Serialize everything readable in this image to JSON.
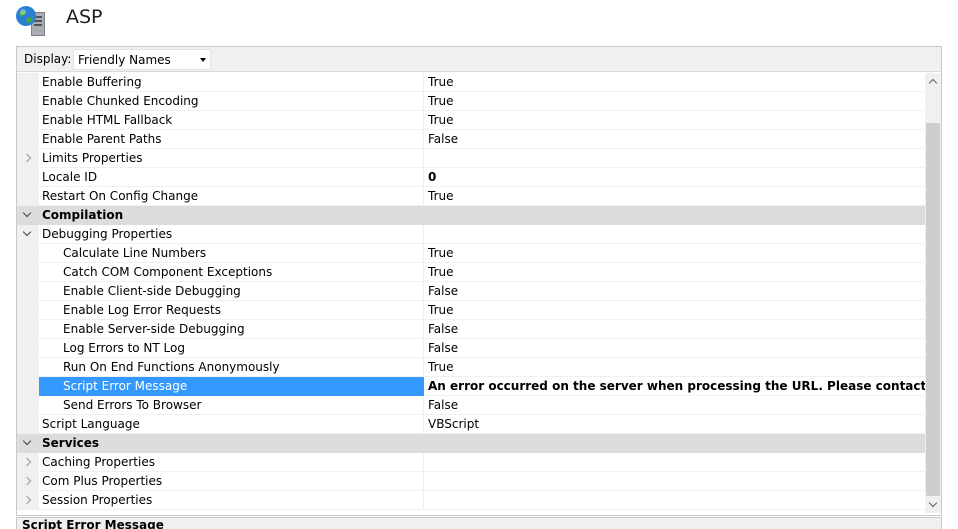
{
  "header": {
    "title": "ASP",
    "icon": "server-globe-icon"
  },
  "display": {
    "label": "Display:",
    "selected": "Friendly Names"
  },
  "rows": [
    {
      "name": "Enable Buffering",
      "value": "True",
      "kind": "prop",
      "indent": false
    },
    {
      "name": "Enable Chunked Encoding",
      "value": "True",
      "kind": "prop",
      "indent": false
    },
    {
      "name": "Enable HTML Fallback",
      "value": "True",
      "kind": "prop",
      "indent": false
    },
    {
      "name": "Enable Parent Paths",
      "value": "False",
      "kind": "prop",
      "indent": false
    },
    {
      "name": "Limits Properties",
      "value": "",
      "kind": "collapsed",
      "indent": false
    },
    {
      "name": "Locale ID",
      "value": "0",
      "kind": "prop",
      "indent": false,
      "bold_value": true
    },
    {
      "name": "Restart On Config Change",
      "value": "True",
      "kind": "prop",
      "indent": false
    },
    {
      "name": "Compilation",
      "value": "",
      "kind": "category",
      "indent": false
    },
    {
      "name": "Debugging Properties",
      "value": "",
      "kind": "expanded",
      "indent": false
    },
    {
      "name": "Calculate Line Numbers",
      "value": "True",
      "kind": "prop",
      "indent": true
    },
    {
      "name": "Catch COM Component Exceptions",
      "value": "True",
      "kind": "prop",
      "indent": true
    },
    {
      "name": "Enable Client-side Debugging",
      "value": "False",
      "kind": "prop",
      "indent": true
    },
    {
      "name": "Enable Log Error Requests",
      "value": "True",
      "kind": "prop",
      "indent": true
    },
    {
      "name": "Enable Server-side Debugging",
      "value": "False",
      "kind": "prop",
      "indent": true
    },
    {
      "name": "Log Errors to NT Log",
      "value": "False",
      "kind": "prop",
      "indent": true
    },
    {
      "name": "Run On End Functions Anonymously",
      "value": "True",
      "kind": "prop",
      "indent": true
    },
    {
      "name": "Script Error Message",
      "value": "An error occurred on the server when processing the URL. Please contact the system adm",
      "kind": "prop",
      "indent": true,
      "selected": true,
      "bold_value": true
    },
    {
      "name": "Send Errors To Browser",
      "value": "False",
      "kind": "prop",
      "indent": true
    },
    {
      "name": "Script Language",
      "value": "VBScript",
      "kind": "prop",
      "indent": false
    },
    {
      "name": "Services",
      "value": "",
      "kind": "category",
      "indent": false
    },
    {
      "name": "Caching Properties",
      "value": "",
      "kind": "collapsed",
      "indent": false
    },
    {
      "name": "Com Plus Properties",
      "value": "",
      "kind": "collapsed",
      "indent": false
    },
    {
      "name": "Session Properties",
      "value": "",
      "kind": "collapsed",
      "indent": false
    }
  ],
  "description": {
    "title": "Script Error Message"
  }
}
